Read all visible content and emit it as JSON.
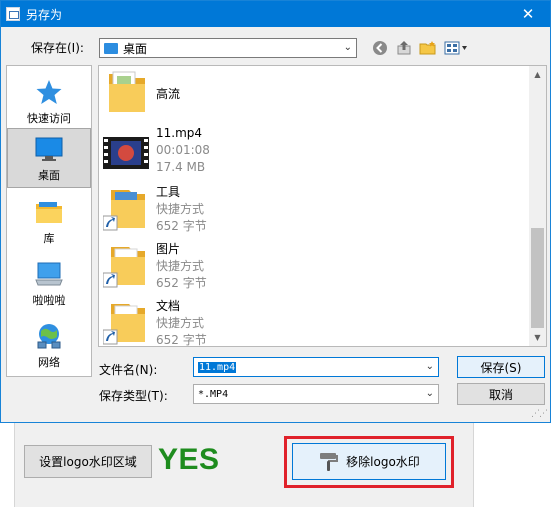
{
  "dialog": {
    "title": "另存为",
    "close_glyph": "✕",
    "save_in_label": "保存在(I):",
    "save_in_value": "桌面"
  },
  "places": [
    {
      "label": "快速访问",
      "icon": "star-icon"
    },
    {
      "label": "桌面",
      "icon": "desktop-icon"
    },
    {
      "label": "库",
      "icon": "library-icon"
    },
    {
      "label": "啦啦啦",
      "icon": "computer-icon"
    },
    {
      "label": "网络",
      "icon": "network-icon"
    }
  ],
  "files": [
    {
      "name": "高流",
      "meta1": "",
      "meta2": "",
      "icon": "folder-icon"
    },
    {
      "name": "11.mp4",
      "meta1": "00:01:08",
      "meta2": "17.4 MB",
      "icon": "video-thumbnail-icon"
    },
    {
      "name": "工具",
      "meta1": "快捷方式",
      "meta2": "652 字节",
      "icon": "folder-shortcut-icon"
    },
    {
      "name": "图片",
      "meta1": "快捷方式",
      "meta2": "652 字节",
      "icon": "folder-shortcut-icon"
    },
    {
      "name": "文档",
      "meta1": "快捷方式",
      "meta2": "652 字节",
      "icon": "folder-shortcut-icon"
    }
  ],
  "form": {
    "filename_label": "文件名(N):",
    "filename_value": "11.mp4",
    "filetype_label": "保存类型(T):",
    "filetype_value": "*.MP4",
    "save_button": "保存(S)",
    "cancel_button": "取消"
  },
  "app": {
    "set_region_button": "设置logo水印区域",
    "status_text": "YES",
    "remove_button": "移除logo水印"
  },
  "colors": {
    "title_bar": "#0078d7",
    "status_green": "#1e8c1e",
    "highlight_red": "#e0212a"
  }
}
